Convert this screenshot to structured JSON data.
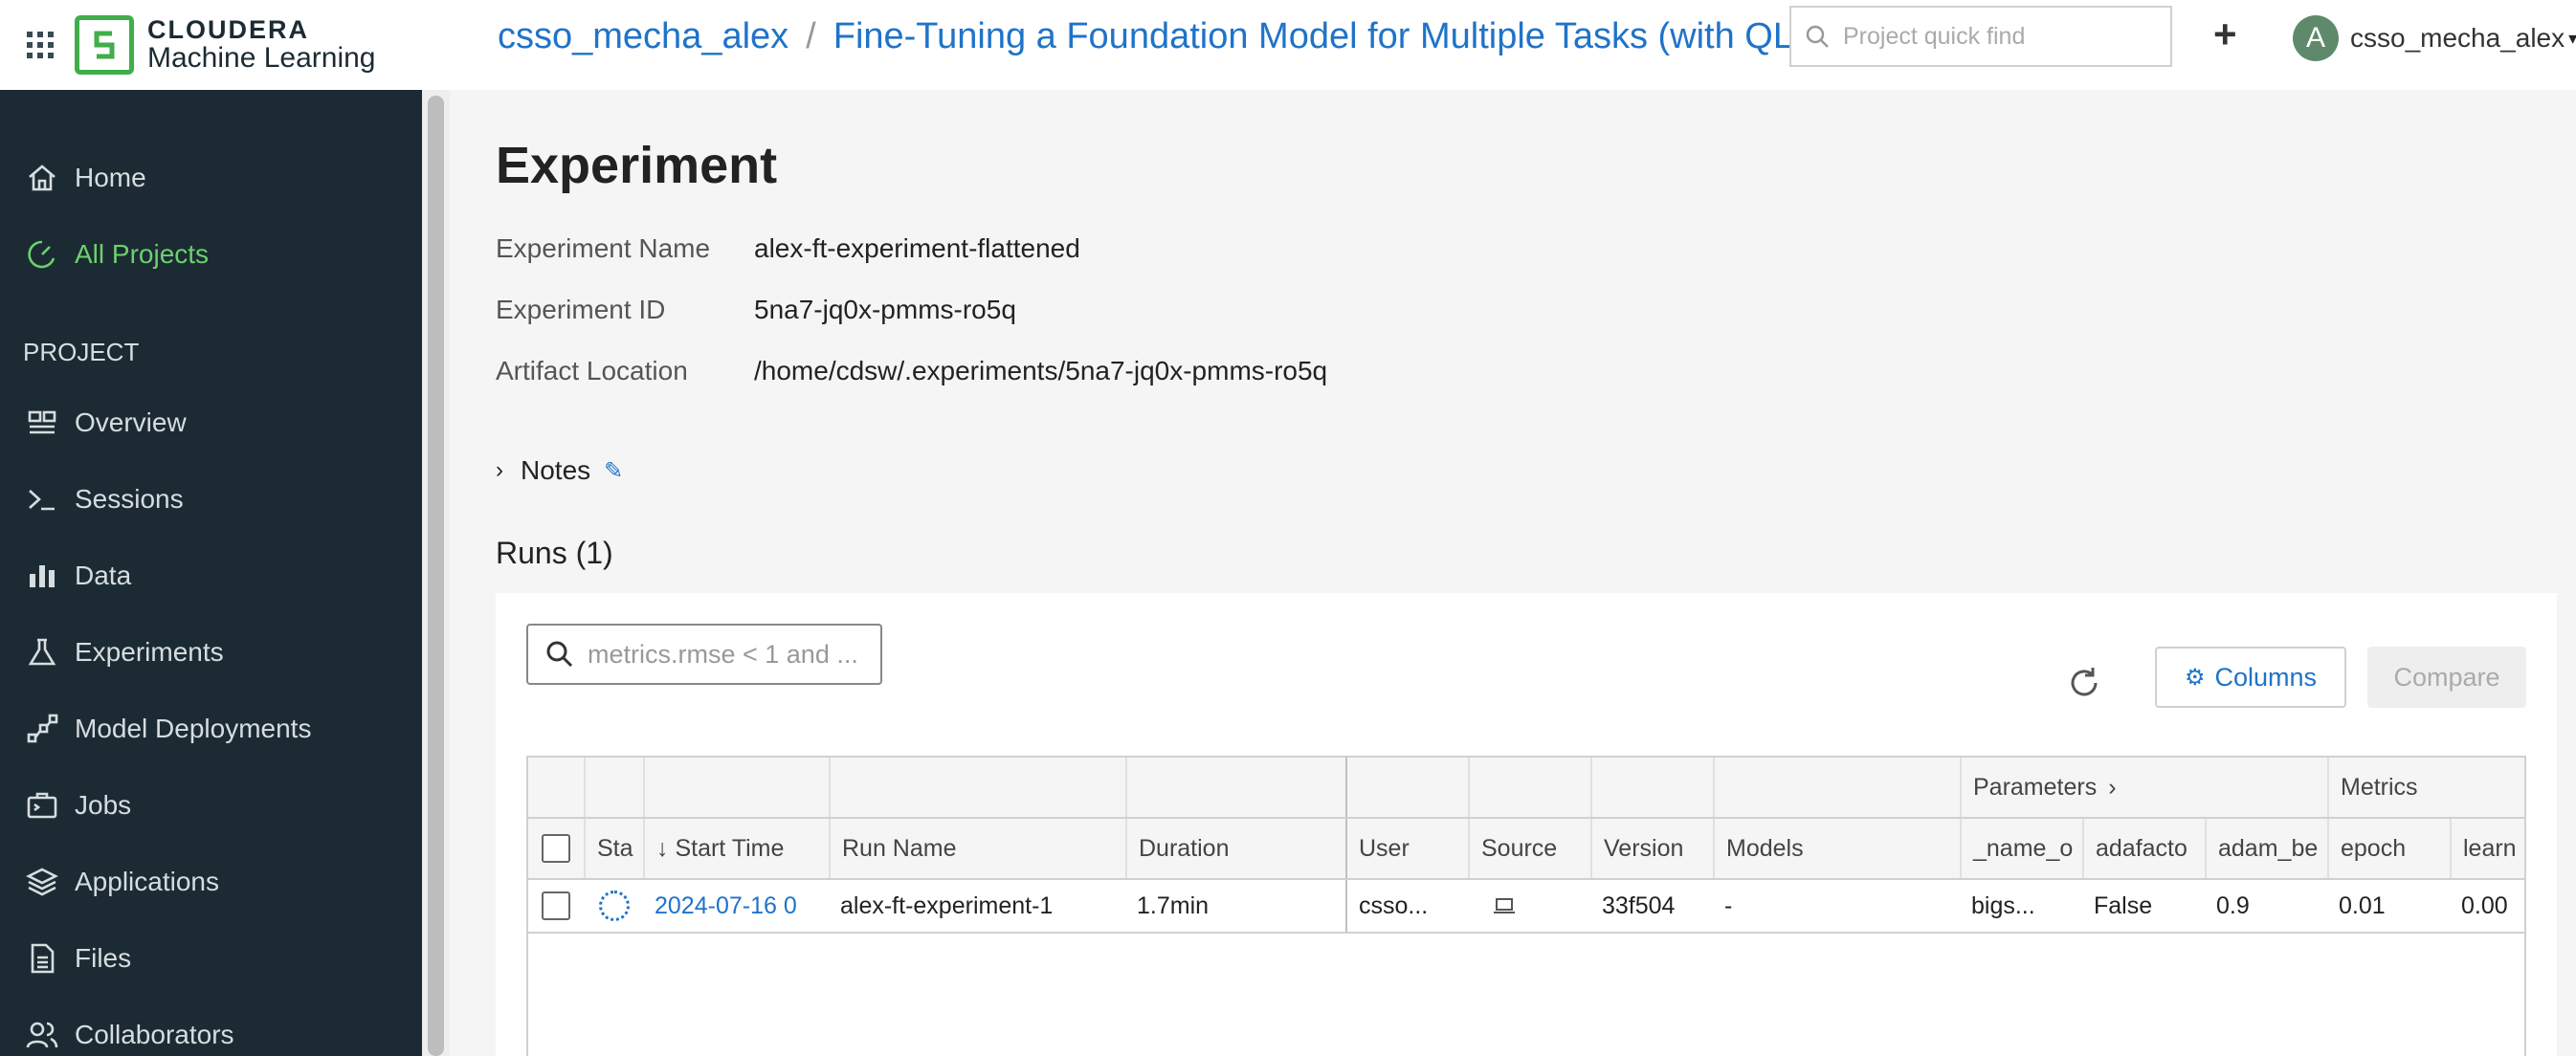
{
  "app": {
    "brand": "CLOUDERA",
    "product": "Machine Learning"
  },
  "sidebar": {
    "items": [
      {
        "label": "Home",
        "icon": "home-icon"
      },
      {
        "label": "All Projects",
        "icon": "gauge-icon",
        "active": true
      }
    ],
    "section_label": "PROJECT",
    "project_items": [
      {
        "label": "Overview",
        "icon": "overview-icon"
      },
      {
        "label": "Sessions",
        "icon": "terminal-icon"
      },
      {
        "label": "Data",
        "icon": "bar-chart-icon"
      },
      {
        "label": "Experiments",
        "icon": "flask-icon"
      },
      {
        "label": "Model Deployments",
        "icon": "model-icon"
      },
      {
        "label": "Jobs",
        "icon": "jobs-icon"
      },
      {
        "label": "Applications",
        "icon": "layers-icon"
      },
      {
        "label": "Files",
        "icon": "file-icon"
      },
      {
        "label": "Collaborators",
        "icon": "people-icon"
      }
    ]
  },
  "header": {
    "breadcrumb_user": "csso_mecha_alex",
    "breadcrumb_sep": "/",
    "breadcrumb_project": "Fine-Tuning a Foundation Model for Multiple Tasks (with QLoRA",
    "quickfind_placeholder": "Project quick find",
    "plus": "+",
    "avatar_letter": "A",
    "username": "csso_mecha_alex"
  },
  "experiment": {
    "title": "Experiment",
    "name_label": "Experiment Name",
    "name_value": "alex-ft-experiment-flattened",
    "id_label": "Experiment ID",
    "id_value": "5na7-jq0x-pmms-ro5q",
    "artifact_label": "Artifact Location",
    "artifact_value": "/home/cdsw/.experiments/5na7-jq0x-pmms-ro5q",
    "notes_label": "Notes",
    "runs_title": "Runs (1)"
  },
  "runs": {
    "search_placeholder": "metrics.rmse < 1 and ...",
    "columns_label": "Columns",
    "compare_label": "Compare",
    "group_headers": {
      "parameters": "Parameters",
      "metrics": "Metrics"
    },
    "columns": [
      "Sta",
      "↓ Start Time",
      "Run Name",
      "Duration",
      "User",
      "Source",
      "Version",
      "Models",
      "_name_o",
      "adafacto",
      "adam_be",
      "epoch",
      "learn"
    ],
    "rows": [
      {
        "start_time": "2024-07-16 0",
        "run_name": "alex-ft-experiment-1",
        "duration": "1.7min",
        "user": "csso...",
        "source_icon": "laptop-icon",
        "version": "33f504",
        "models": "-",
        "name_o": "bigs...",
        "adafactor": "False",
        "adam_beta": "0.9",
        "epoch": "0.01",
        "learn": "0.00"
      }
    ]
  },
  "colors": {
    "sidebar_bg": "#1c2b33",
    "accent_green": "#6bd16e",
    "link_blue": "#1f73c9"
  }
}
